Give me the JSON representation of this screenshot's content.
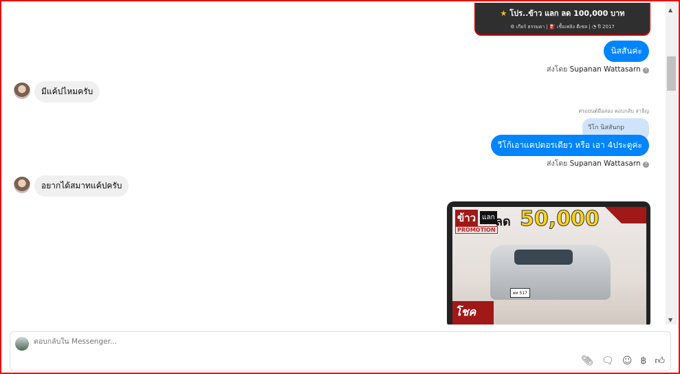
{
  "messages": {
    "card_top": {
      "title": "โปร..ข้าว แลก ลด 100,000 บาท",
      "specs": "⚙ เกียร์ ธรรมดา  |  ⛽ เชื้อเพลิง ดีเซล  |  ◔ ปี 2017"
    },
    "out1": "นิสสันค่ะ",
    "sent_prefix": "ส่งโดย",
    "sender": "Supanan Wattasarn",
    "in1": "มีแค้ปไหมครับ",
    "reply_note": "ศรถยนต์มือสอง ตอบกลับ สาธิญ",
    "quoted": "วีโก นิสสันnp",
    "out2": "วีโก้เอาแคปตอรเดียว หรือ เอา 4ประตูค่ะ",
    "in2": "อยากได้สมาทแค้ปครับ",
    "image": {
      "brand": "ข้าว",
      "swap": "แลก",
      "discount": "ลด",
      "amount": "50,000",
      "promo": "PROMOTION",
      "luck": "โชค",
      "plate": "ผห 517"
    }
  },
  "composer": {
    "placeholder": "ตอบกลับใน Messenger..."
  },
  "tools": [
    "paperclip-icon",
    "sticker-icon",
    "emoji-icon",
    "baht-icon",
    "like-icon"
  ]
}
